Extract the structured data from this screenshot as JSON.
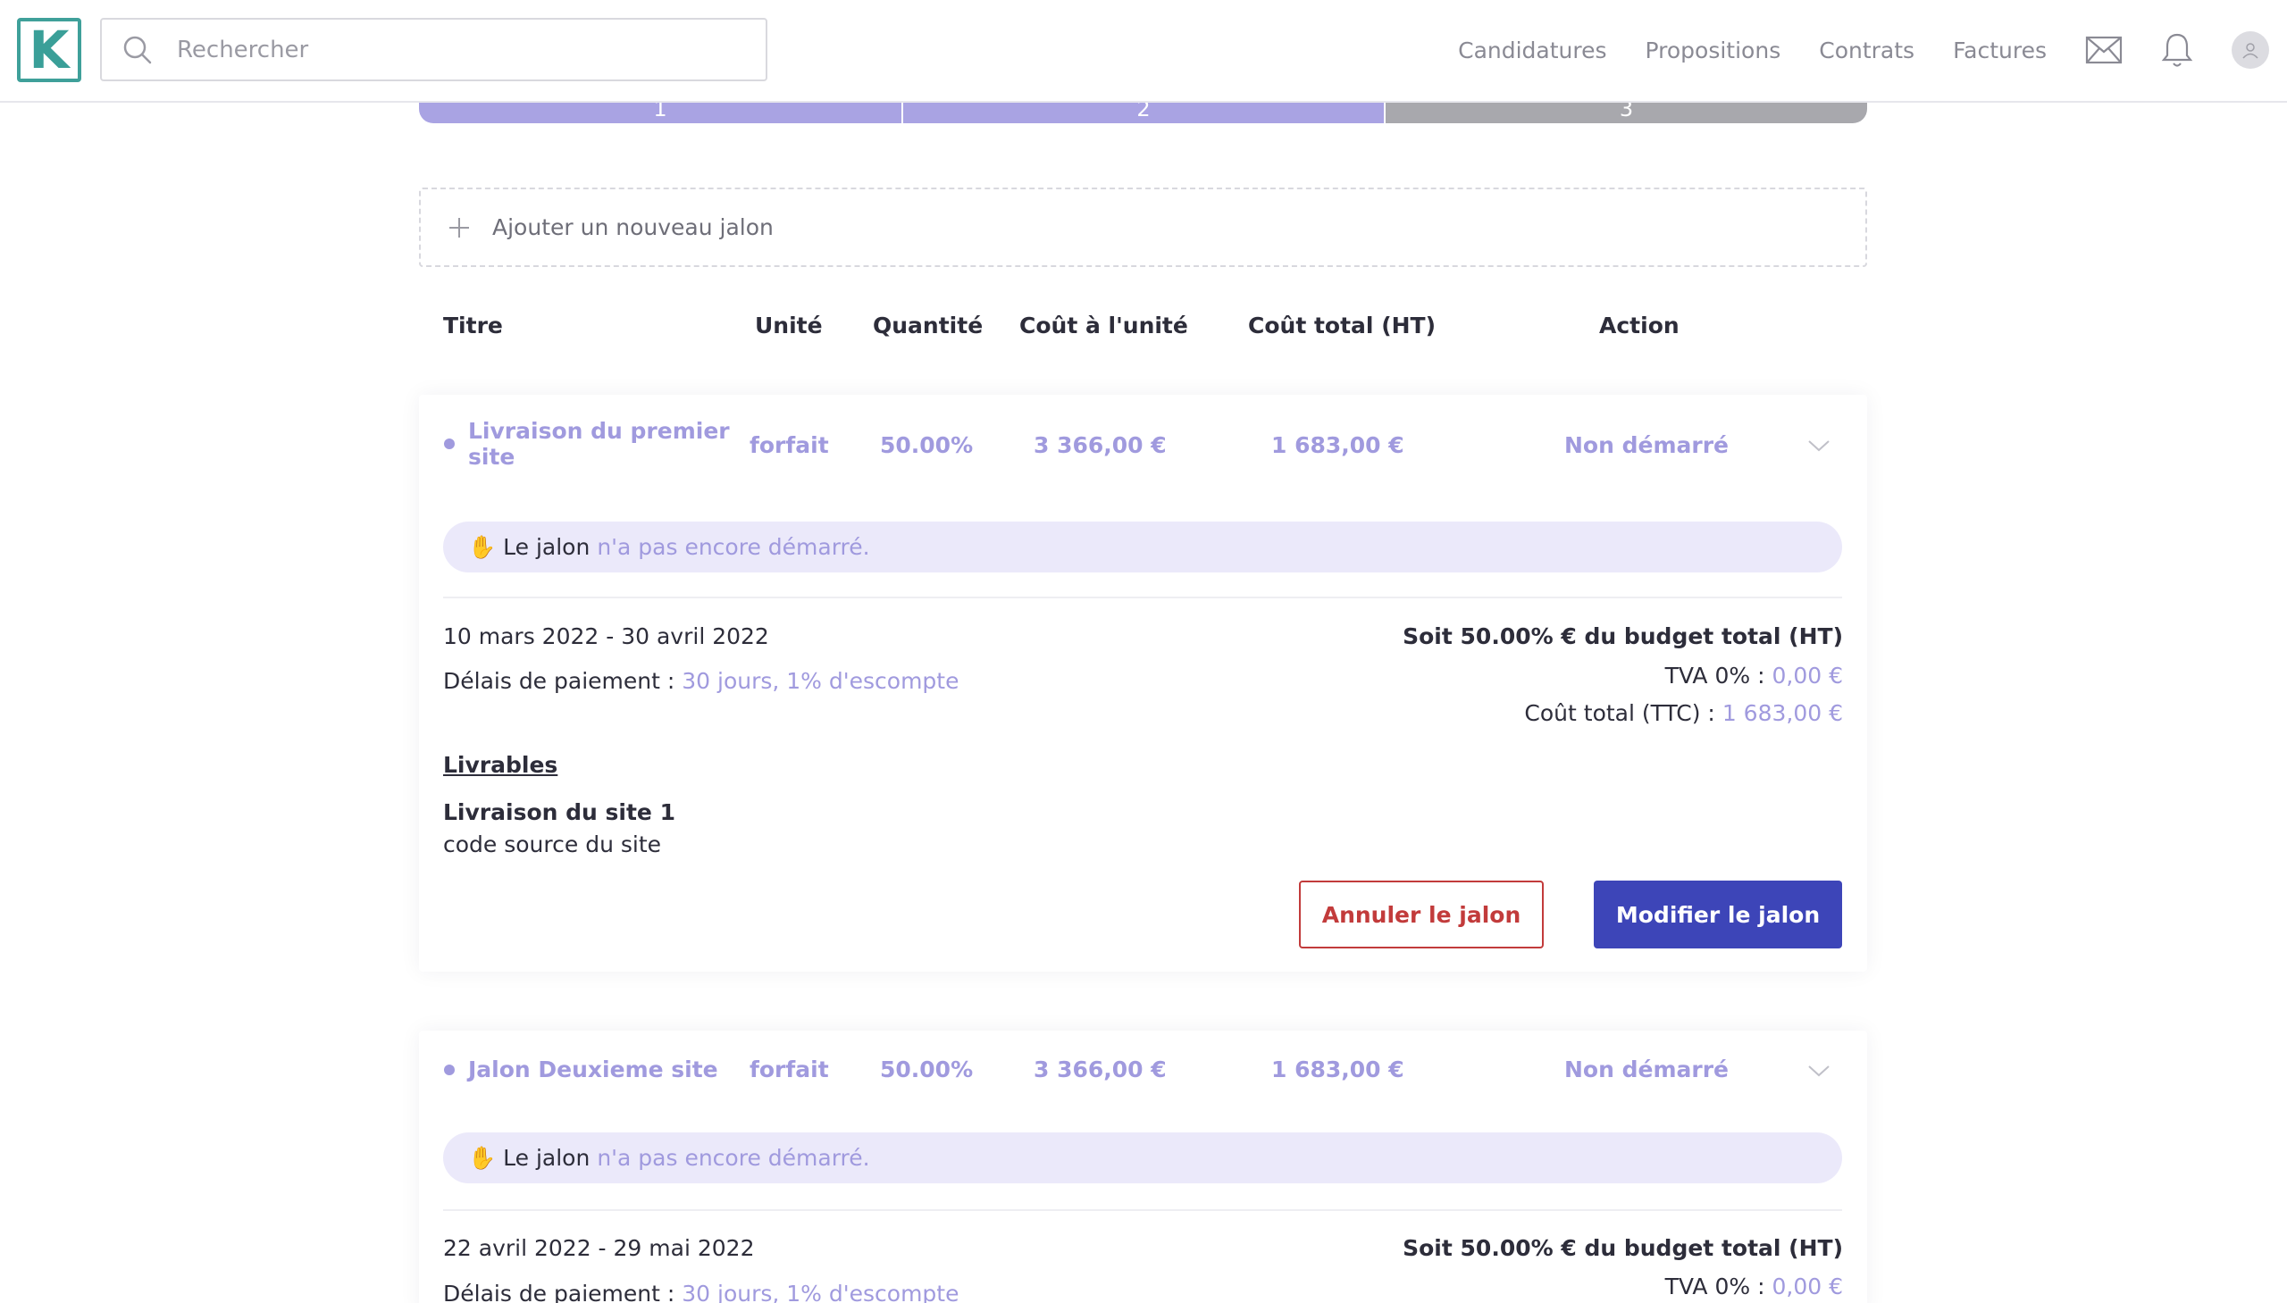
{
  "header": {
    "logo_letter": "K",
    "search_placeholder": "Rechercher",
    "nav": [
      "Candidatures",
      "Propositions",
      "Contrats",
      "Factures"
    ],
    "icons": [
      "mail-icon",
      "bell-icon",
      "avatar"
    ]
  },
  "stepper": {
    "steps": [
      {
        "label": "1",
        "state": "done"
      },
      {
        "label": "2",
        "state": "done"
      },
      {
        "label": "3",
        "state": "todo"
      }
    ]
  },
  "add_milestone_label": "Ajouter un nouveau jalon",
  "table_headers": {
    "title": "Titre",
    "unit": "Unité",
    "quantity": "Quantité",
    "unit_cost": "Coût à l'unité",
    "total_cost": "Coût total (HT)",
    "action": "Action"
  },
  "milestones": [
    {
      "title_line1": "Livraison du premier",
      "title_line2": "site",
      "unit": "forfait",
      "quantity": "50.00%",
      "unit_cost": "3 366,00 €",
      "total_cost": "1 683,00 €",
      "status": "Non démarré",
      "notice_prefix": "Le jalon",
      "notice_suffix": "n'a pas encore démarré.",
      "dates": "10 mars 2022 - 30 avril 2022",
      "payment_label": "Délais de paiement :",
      "payment_value": "30 jours, 1% d'escompte",
      "budget_share": "Soit 50.00% € du budget total (HT)",
      "tva_label": "TVA 0% :",
      "tva_value": "0,00 €",
      "ttc_label": "Coût total (TTC) :",
      "ttc_value": "1 683,00 €",
      "deliverables_heading": "Livrables",
      "deliverable_title": "Livraison du site 1",
      "deliverable_desc": "code source du site",
      "cancel_label": "Annuler le jalon",
      "edit_label": "Modifier le jalon"
    },
    {
      "title_line1": "Jalon Deuxieme site",
      "unit": "forfait",
      "quantity": "50.00%",
      "unit_cost": "3 366,00 €",
      "total_cost": "1 683,00 €",
      "status": "Non démarré",
      "notice_prefix": "Le jalon",
      "notice_suffix": "n'a pas encore démarré.",
      "dates": "22 avril 2022 - 29 mai 2022",
      "payment_label": "Délais de paiement :",
      "payment_value": "30 jours, 1% d'escompte",
      "budget_share": "Soit 50.00% € du budget total (HT)",
      "tva_label": "TVA 0% :",
      "tva_value": "0,00 €"
    }
  ],
  "colors": {
    "accent": "#a09ade",
    "primary": "#3d45b8",
    "danger": "#c23b3b",
    "notice_bg": "#ebe9fa",
    "step_done": "#a9a3e3",
    "step_todo": "#a8a8ad",
    "logo": "#3fa09a"
  }
}
